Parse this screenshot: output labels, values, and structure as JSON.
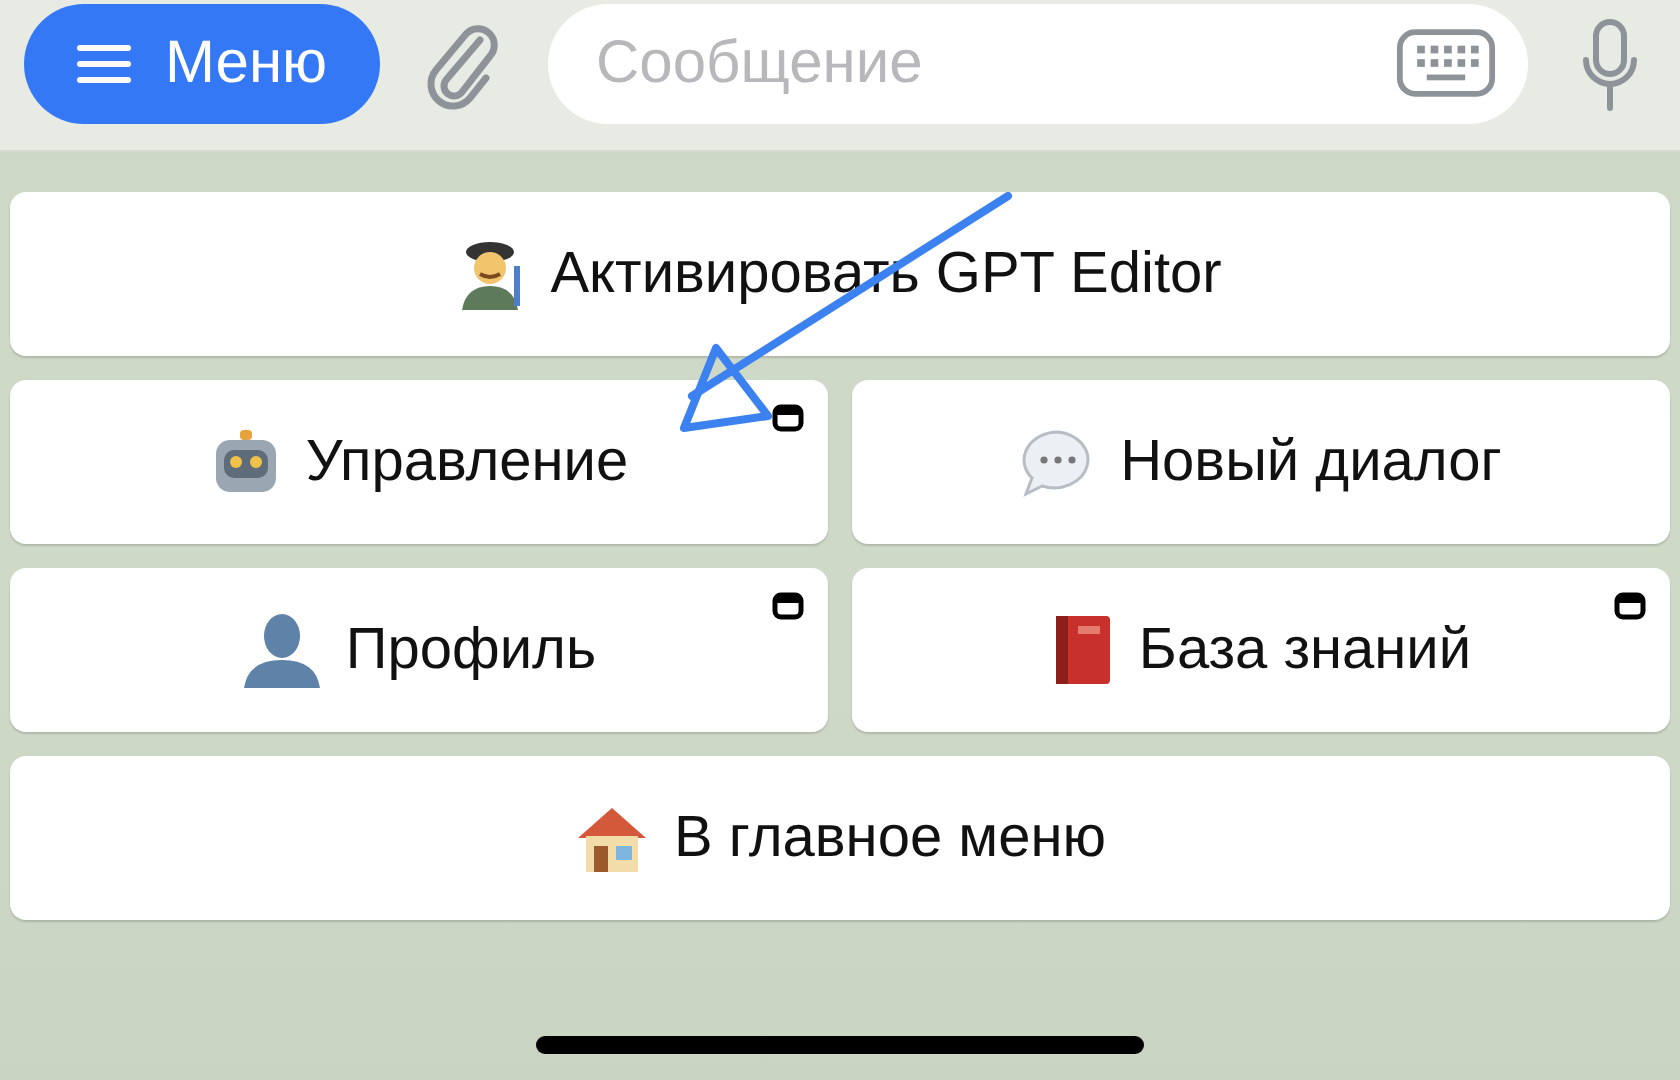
{
  "menu_button": {
    "label": "Меню"
  },
  "message_field": {
    "placeholder": "Сообщение"
  },
  "keyboard_rows": [
    [
      {
        "label": "Активировать GPT Editor",
        "web_app": false
      }
    ],
    [
      {
        "label": "Управление",
        "web_app": true
      },
      {
        "label": "Новый диалог",
        "web_app": false
      }
    ],
    [
      {
        "label": "Профиль",
        "web_app": true
      },
      {
        "label": "База знаний",
        "web_app": true
      }
    ],
    [
      {
        "label": "В главное меню",
        "web_app": false
      }
    ]
  ]
}
